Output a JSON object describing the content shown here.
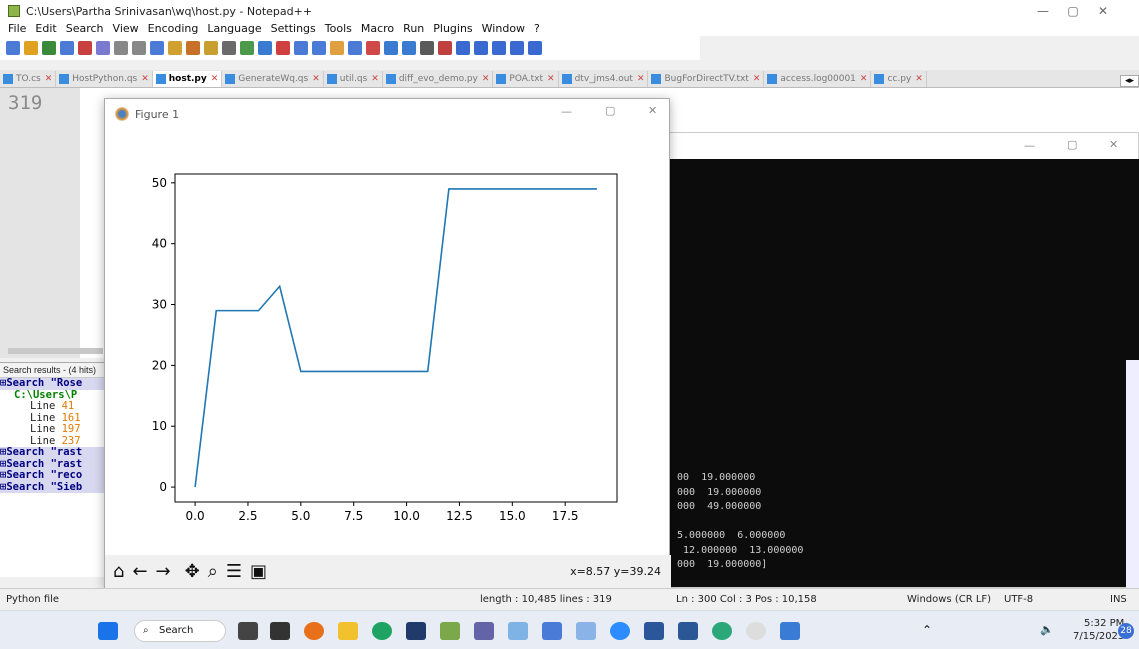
{
  "window": {
    "title": "C:\\Users\\Partha Srinivasan\\wq\\host.py - Notepad++"
  },
  "menu": [
    "File",
    "Edit",
    "Search",
    "View",
    "Encoding",
    "Language",
    "Settings",
    "Tools",
    "Macro",
    "Run",
    "Plugins",
    "Window",
    "?"
  ],
  "tabs": [
    {
      "label": "TO.cs",
      "active": false
    },
    {
      "label": "HostPython.qs",
      "active": false
    },
    {
      "label": "host.py",
      "active": true
    },
    {
      "label": "GenerateWq.qs",
      "active": false
    },
    {
      "label": "util.qs",
      "active": false
    },
    {
      "label": "diff_evo_demo.py",
      "active": false
    },
    {
      "label": "POA.txt",
      "active": false
    },
    {
      "label": "dtv_jms4.out",
      "active": false
    },
    {
      "label": "BugForDirectTV.txt",
      "active": false
    },
    {
      "label": "access.log00001",
      "active": false
    },
    {
      "label": "cc.py",
      "active": false
    }
  ],
  "editor": {
    "line_number": "319"
  },
  "search_panel": {
    "header": "Search results - (4 hits)",
    "rows": [
      {
        "kind": "q",
        "text": "Search \"Rose"
      },
      {
        "kind": "path",
        "text": "C:\\Users\\P"
      },
      {
        "kind": "line",
        "label": "Line ",
        "num": "41"
      },
      {
        "kind": "line",
        "label": "Line ",
        "num": "161"
      },
      {
        "kind": "line",
        "label": "Line ",
        "num": "197"
      },
      {
        "kind": "line",
        "label": "Line ",
        "num": "237"
      },
      {
        "kind": "q",
        "text": "Search \"rast"
      },
      {
        "kind": "q",
        "text": "Search \"rast"
      },
      {
        "kind": "q",
        "text": "Search \"reco"
      },
      {
        "kind": "q",
        "text": "Search \"Sieb"
      }
    ]
  },
  "console": {
    "lines": [
      "00  19.000000",
      "000  19.000000",
      "000  49.000000",
      "",
      "5.000000  6.000000",
      " 12.000000  13.000000",
      "000  19.000000]"
    ]
  },
  "figure": {
    "title": "Figure 1",
    "coords": "x=8.57 y=39.24",
    "toolbar_icons": [
      "home-icon",
      "back-icon",
      "forward-icon",
      "pan-icon",
      "zoom-icon",
      "configure-icon",
      "save-icon"
    ]
  },
  "chart_data": {
    "type": "line",
    "title": "",
    "xlabel": "",
    "ylabel": "",
    "x": [
      0,
      1,
      2,
      3,
      4,
      5,
      6,
      7,
      8,
      9,
      10,
      11,
      12,
      13,
      14,
      15,
      16,
      17,
      18,
      19
    ],
    "y": [
      0,
      29,
      29,
      29,
      33,
      19,
      19,
      19,
      19,
      19,
      19,
      19,
      49,
      49,
      49,
      49,
      49,
      49,
      49,
      49
    ],
    "xticks": [
      "0.0",
      "2.5",
      "5.0",
      "7.5",
      "10.0",
      "12.5",
      "15.0",
      "17.5"
    ],
    "xtick_values": [
      0,
      2.5,
      5,
      7.5,
      10,
      12.5,
      15,
      17.5
    ],
    "yticks": [
      "0",
      "10",
      "20",
      "30",
      "40",
      "50"
    ],
    "ytick_values": [
      0,
      10,
      20,
      30,
      40,
      50
    ],
    "xlim": [
      -0.95,
      19.95
    ],
    "ylim": [
      -2.45,
      51.45
    ],
    "color": "#1f77b4"
  },
  "statusbar": {
    "filetype": "Python file",
    "length": "length : 10,485   lines : 319",
    "position": "Ln : 300   Col : 3   Pos : 10,158",
    "eol": "Windows (CR LF)",
    "encoding": "UTF-8",
    "mode": "INS"
  },
  "taskbar": {
    "search": "Search",
    "time": "5:32 PM",
    "date": "7/15/2023",
    "notifications": "28"
  }
}
